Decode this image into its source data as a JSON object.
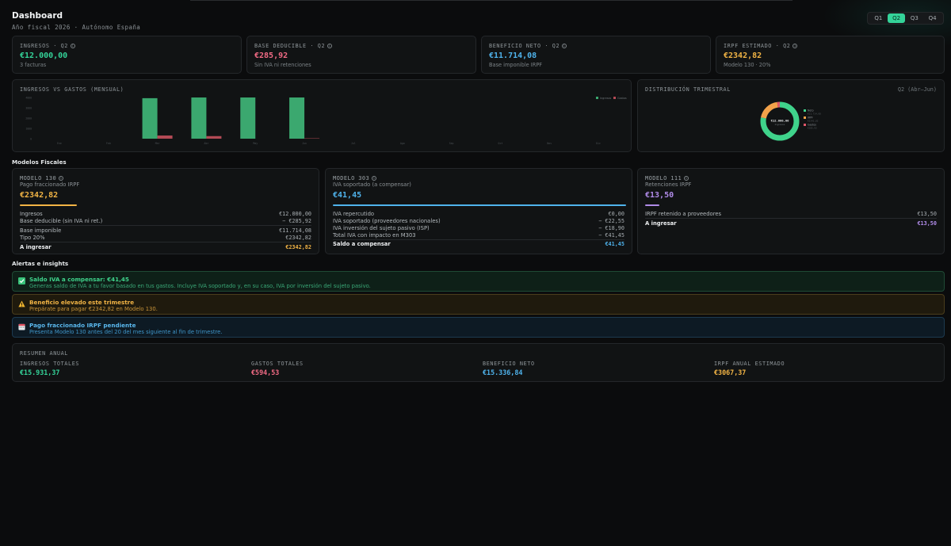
{
  "header": {
    "title": "Dashboard",
    "subtitle": "Año fiscal 2026 · Autónomo España"
  },
  "quarters": {
    "items": [
      "Q1",
      "Q2",
      "Q3",
      "Q4"
    ],
    "active": "Q2"
  },
  "kpis": [
    {
      "label": "INGRESOS · Q2",
      "value": "€12.000,00",
      "note": "3 facturas",
      "color": "#34d399"
    },
    {
      "label": "BASE DEDUCIBLE · Q2",
      "value": "€285,92",
      "note": "Sin IVA ni retenciones",
      "color": "#f26b85"
    },
    {
      "label": "BENEFICIO NETO · Q2",
      "value": "€11.714,08",
      "note": "Base imponible IRPF",
      "color": "#4fb3ec"
    },
    {
      "label": "IRPF ESTIMADO · Q2",
      "value": "€2342,82",
      "note": "Modelo 130 · 20%",
      "color": "#f2b445"
    }
  ],
  "chart_data": [
    {
      "type": "bar",
      "title": "INGRESOS VS GASTOS (MENSUAL)",
      "categories": [
        "Ene",
        "Feb",
        "Mar",
        "Abr",
        "May",
        "Jun",
        "Jul",
        "Ago",
        "Sep",
        "Oct",
        "Nov",
        "Dic"
      ],
      "series": [
        {
          "name": "Ingresos",
          "color": "#3ba86f",
          "values": [
            0,
            0,
            3931.37,
            4000,
            4000,
            4000,
            0,
            0,
            0,
            0,
            0,
            0
          ]
        },
        {
          "name": "Gastos",
          "color": "#b34a55",
          "values": [
            0,
            0,
            308.61,
            250,
            0,
            35.92,
            0,
            0,
            0,
            0,
            0,
            0
          ]
        }
      ],
      "yticks": [
        "4000",
        "3000",
        "2000",
        "1000",
        "0"
      ],
      "ylim": [
        0,
        4000
      ],
      "legend": "top-right",
      "grid": false
    },
    {
      "type": "pie",
      "title": "DISTRIBUCIÓN TRIMESTRAL",
      "period": "Q2 (Abr–Jun)",
      "center_value": "€12.000,00",
      "center_label": "Ingresos",
      "slices": [
        {
          "name": "Neto",
          "value": 9371.26,
          "color": "#3fd38b",
          "detail": "€11.714,08"
        },
        {
          "name": "IRPF",
          "value": 2342.82,
          "color": "#f2a24a",
          "detail": "€2342,82"
        },
        {
          "name": "Gastos",
          "value": 285.92,
          "color": "#e0566a",
          "detail": "€285,92"
        }
      ],
      "legend": "right"
    }
  ],
  "sections": {
    "models": "Modelos Fiscales",
    "alerts": "Alertas e insights"
  },
  "models": {
    "m130": {
      "title": "MODELO 130",
      "subtitle": "Pago fraccionado IRPF",
      "value": "€2342,82",
      "color": "#f2b445",
      "rows": [
        {
          "label": "Ingresos",
          "value": "€12.000,00"
        },
        {
          "label": "Base deducible (sin IVA ni ret.)",
          "value": "− €285,92"
        },
        {
          "label": "Base imponible",
          "value": "€11.714,08"
        },
        {
          "label": "Tipo 20%",
          "value": "€2342,82"
        }
      ],
      "total_label": "A ingresar",
      "total_value": "€2342,82"
    },
    "m303": {
      "title": "MODELO 303",
      "subtitle": "IVA soportado (a compensar)",
      "value": "€41,45",
      "color": "#4fb3ec",
      "rows": [
        {
          "label": "IVA repercutido",
          "value": "€0,00"
        },
        {
          "label": "IVA soportado (proveedores nacionales)",
          "value": "− €22,55"
        },
        {
          "label": "IVA inversión del sujeto pasivo (ISP)",
          "value": "− €18,90"
        },
        {
          "label": "Total IVA con impacto en M303",
          "value": "− €41,45"
        }
      ],
      "total_label": "Saldo a compensar",
      "total_value": "€41,45"
    },
    "m111": {
      "title": "MODELO 111",
      "subtitle": "Retenciones IRPF",
      "value": "€13,50",
      "color": "#b08be8",
      "rows": [
        {
          "label": "IRPF retenido a proveedores",
          "value": "€13,50"
        }
      ],
      "total_label": "A ingresar",
      "total_value": "€13,50"
    }
  },
  "alerts": [
    {
      "title": "Saldo IVA a compensar: €41,45",
      "text": "Generas saldo de IVA a tu favor basado en tus gastos. Incluye IVA soportado y, en su caso, IVA por inversión del sujeto pasivo.",
      "icon": "check-icon"
    },
    {
      "title": "Beneficio elevado este trimestre",
      "text": "Prepárate para pagar €2342,82 en Modelo 130.",
      "icon": "warning-icon"
    },
    {
      "title": "Pago fraccionado IRPF pendiente",
      "text": "Presenta Modelo 130 antes del 20 del mes siguiente al fin de trimestre.",
      "icon": "calendar-icon"
    }
  ],
  "summary": {
    "title": "RESUMEN ANUAL",
    "items": [
      {
        "label": "INGRESOS TOTALES",
        "value": "€15.931,37",
        "color": "#34d399"
      },
      {
        "label": "GASTOS TOTALES",
        "value": "€594,53",
        "color": "#f26b85"
      },
      {
        "label": "BENEFICIO NETO",
        "value": "€15.336,84",
        "color": "#4fb3ec"
      },
      {
        "label": "IRPF ANUAL ESTIMADO",
        "value": "€3067,37",
        "color": "#f2b445"
      }
    ]
  }
}
